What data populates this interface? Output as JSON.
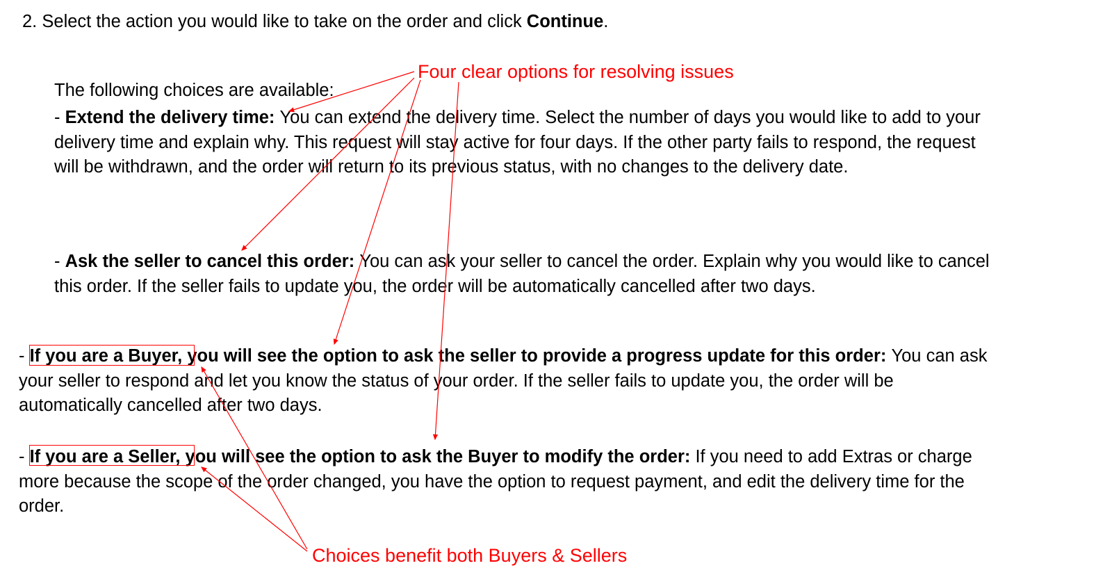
{
  "step": {
    "number": "2.",
    "intro_a": "Select the action you would like to take on the order and click ",
    "intro_b": "Continue",
    "intro_c": "."
  },
  "choices_header": "The following choices are available:",
  "opt1": {
    "dash": "- ",
    "label": "Extend the delivery time: ",
    "body": "You can extend the delivery time. Select the number of days you would like to add to your delivery time and explain why.  This request will stay active for four days.  If the other party fails to respond, the request will be withdrawn, and the order will return to its previous status, with no changes to the delivery date."
  },
  "opt2": {
    "dash": "- ",
    "label": "Ask the seller to cancel this order: ",
    "body": "You can ask your seller to cancel the order. Explain why you would like to cancel this order.  If the seller fails to update you, the order will be automatically cancelled after two days."
  },
  "opt3": {
    "dash": "- ",
    "label": "If you are a Buyer, you will see the option to ask the seller to provide a progress update for this order: ",
    "body": "You can ask your seller to respond and let you know the status of your order.  If the seller fails to update you, the order will be automatically cancelled after two days."
  },
  "opt4": {
    "dash": "- ",
    "label": "If you are a Seller, you will see the option to ask the Buyer to modify the order: ",
    "body": "If you need to add Extras or charge more because the scope of the order changed, you have the option to request payment, and edit the delivery time for the order."
  },
  "annotations": {
    "top": "Four clear options for resolving issues",
    "bottom": "Choices benefit both Buyers & Sellers"
  },
  "colors": {
    "annotation": "#ff0000",
    "text": "#000000"
  }
}
